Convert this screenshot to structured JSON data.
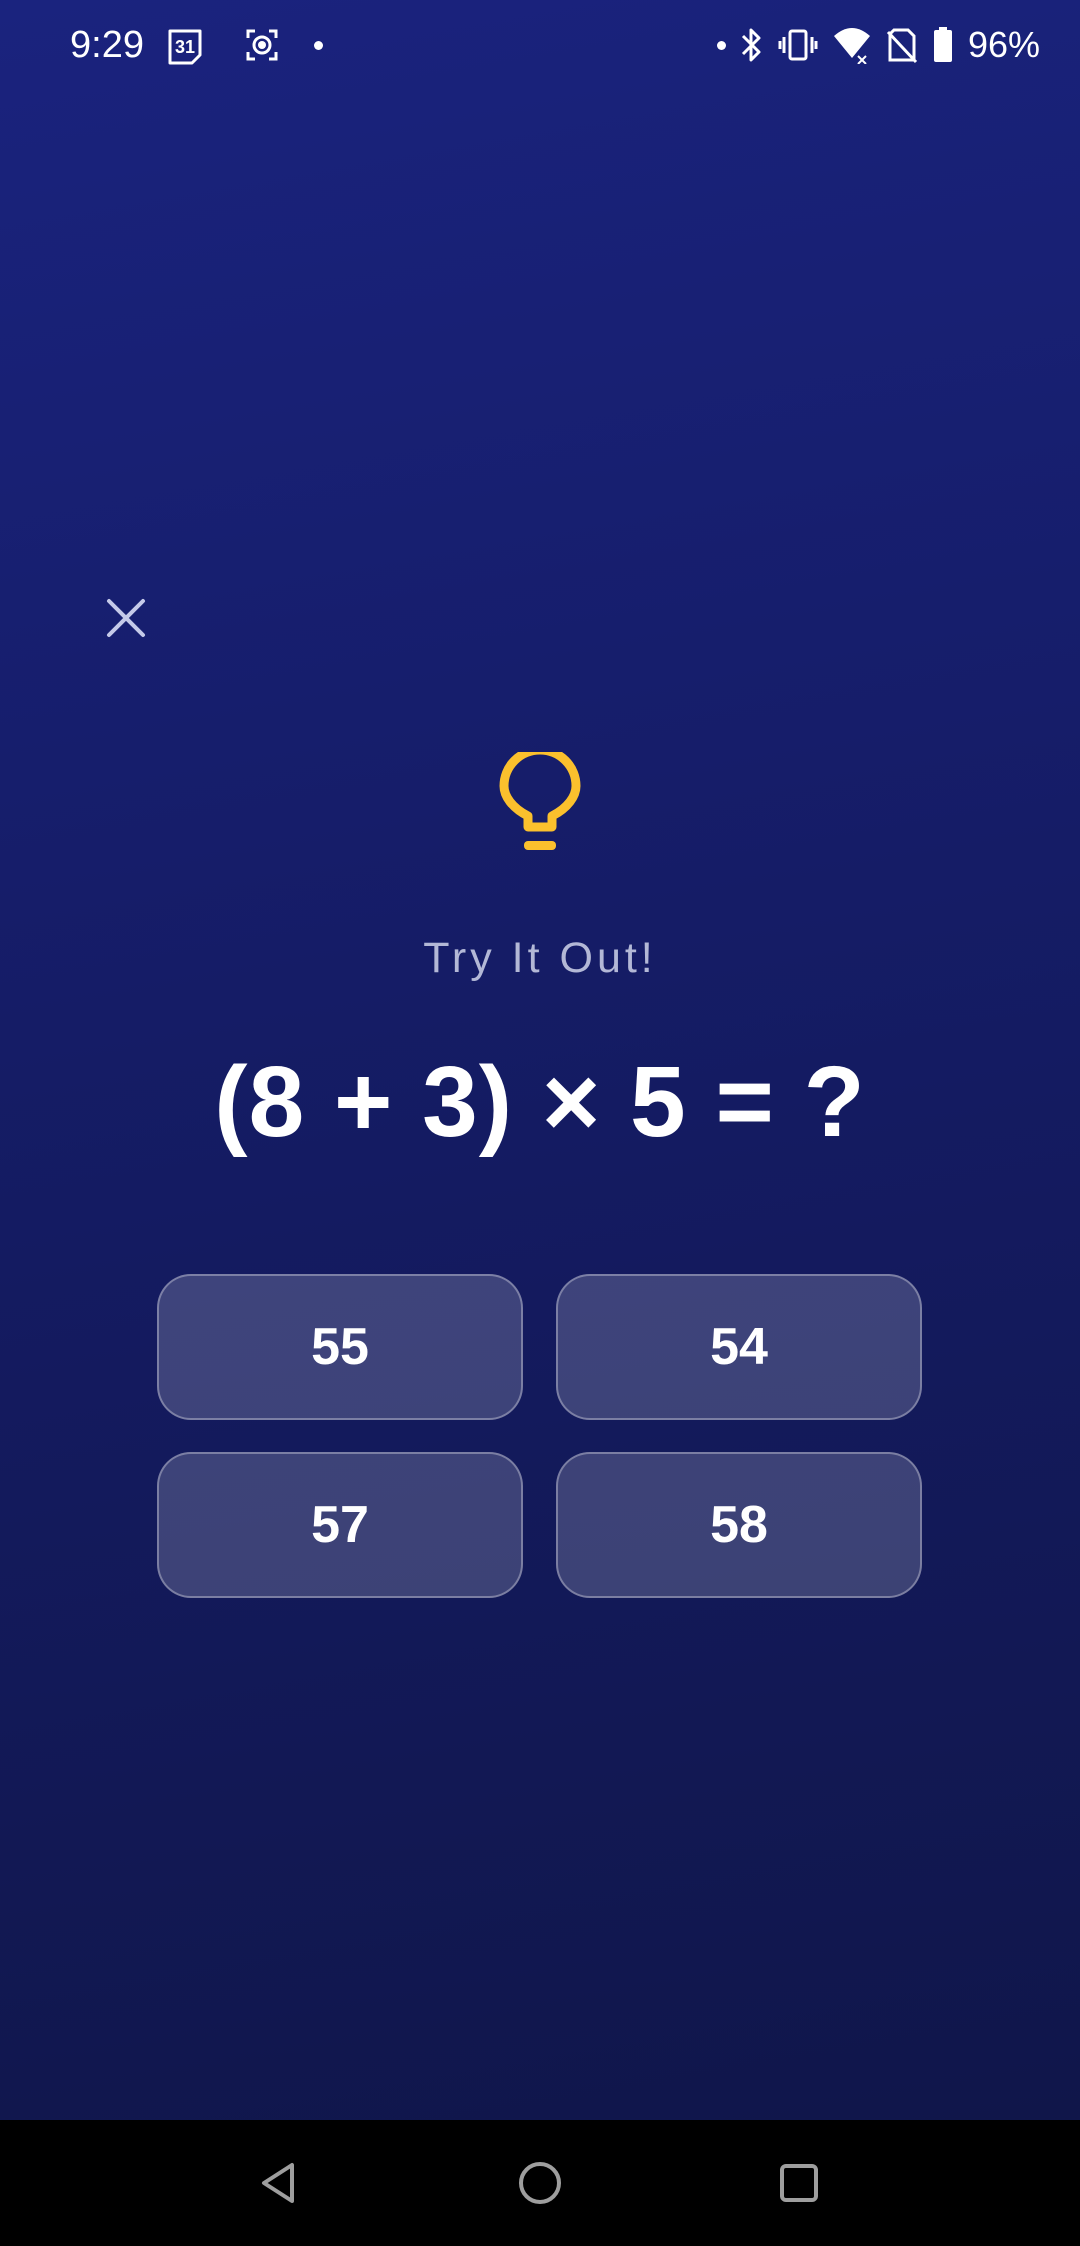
{
  "status_bar": {
    "time": "9:29",
    "calendar_day": "31",
    "battery_percent": "96%",
    "icons": [
      "calendar-icon",
      "screen-record-icon",
      "notification-dot",
      "bluetooth-icon",
      "vibrate-icon",
      "wifi-icon",
      "no-sim-icon",
      "battery-icon"
    ]
  },
  "quiz": {
    "icon": "lightbulb-icon",
    "accent_color": "#fbc02d",
    "subtitle": "Try It Out!",
    "equation": "(8 + 3) × 5 = ?",
    "answers": [
      "55",
      "54",
      "57",
      "58"
    ]
  },
  "nav_bar": {
    "icons": [
      "back-icon",
      "home-icon",
      "recents-icon"
    ]
  },
  "colors": {
    "background_top": "#1a237e",
    "background_bottom": "#10164a",
    "answer_fill": "rgba(255,255,255,0.18)"
  }
}
